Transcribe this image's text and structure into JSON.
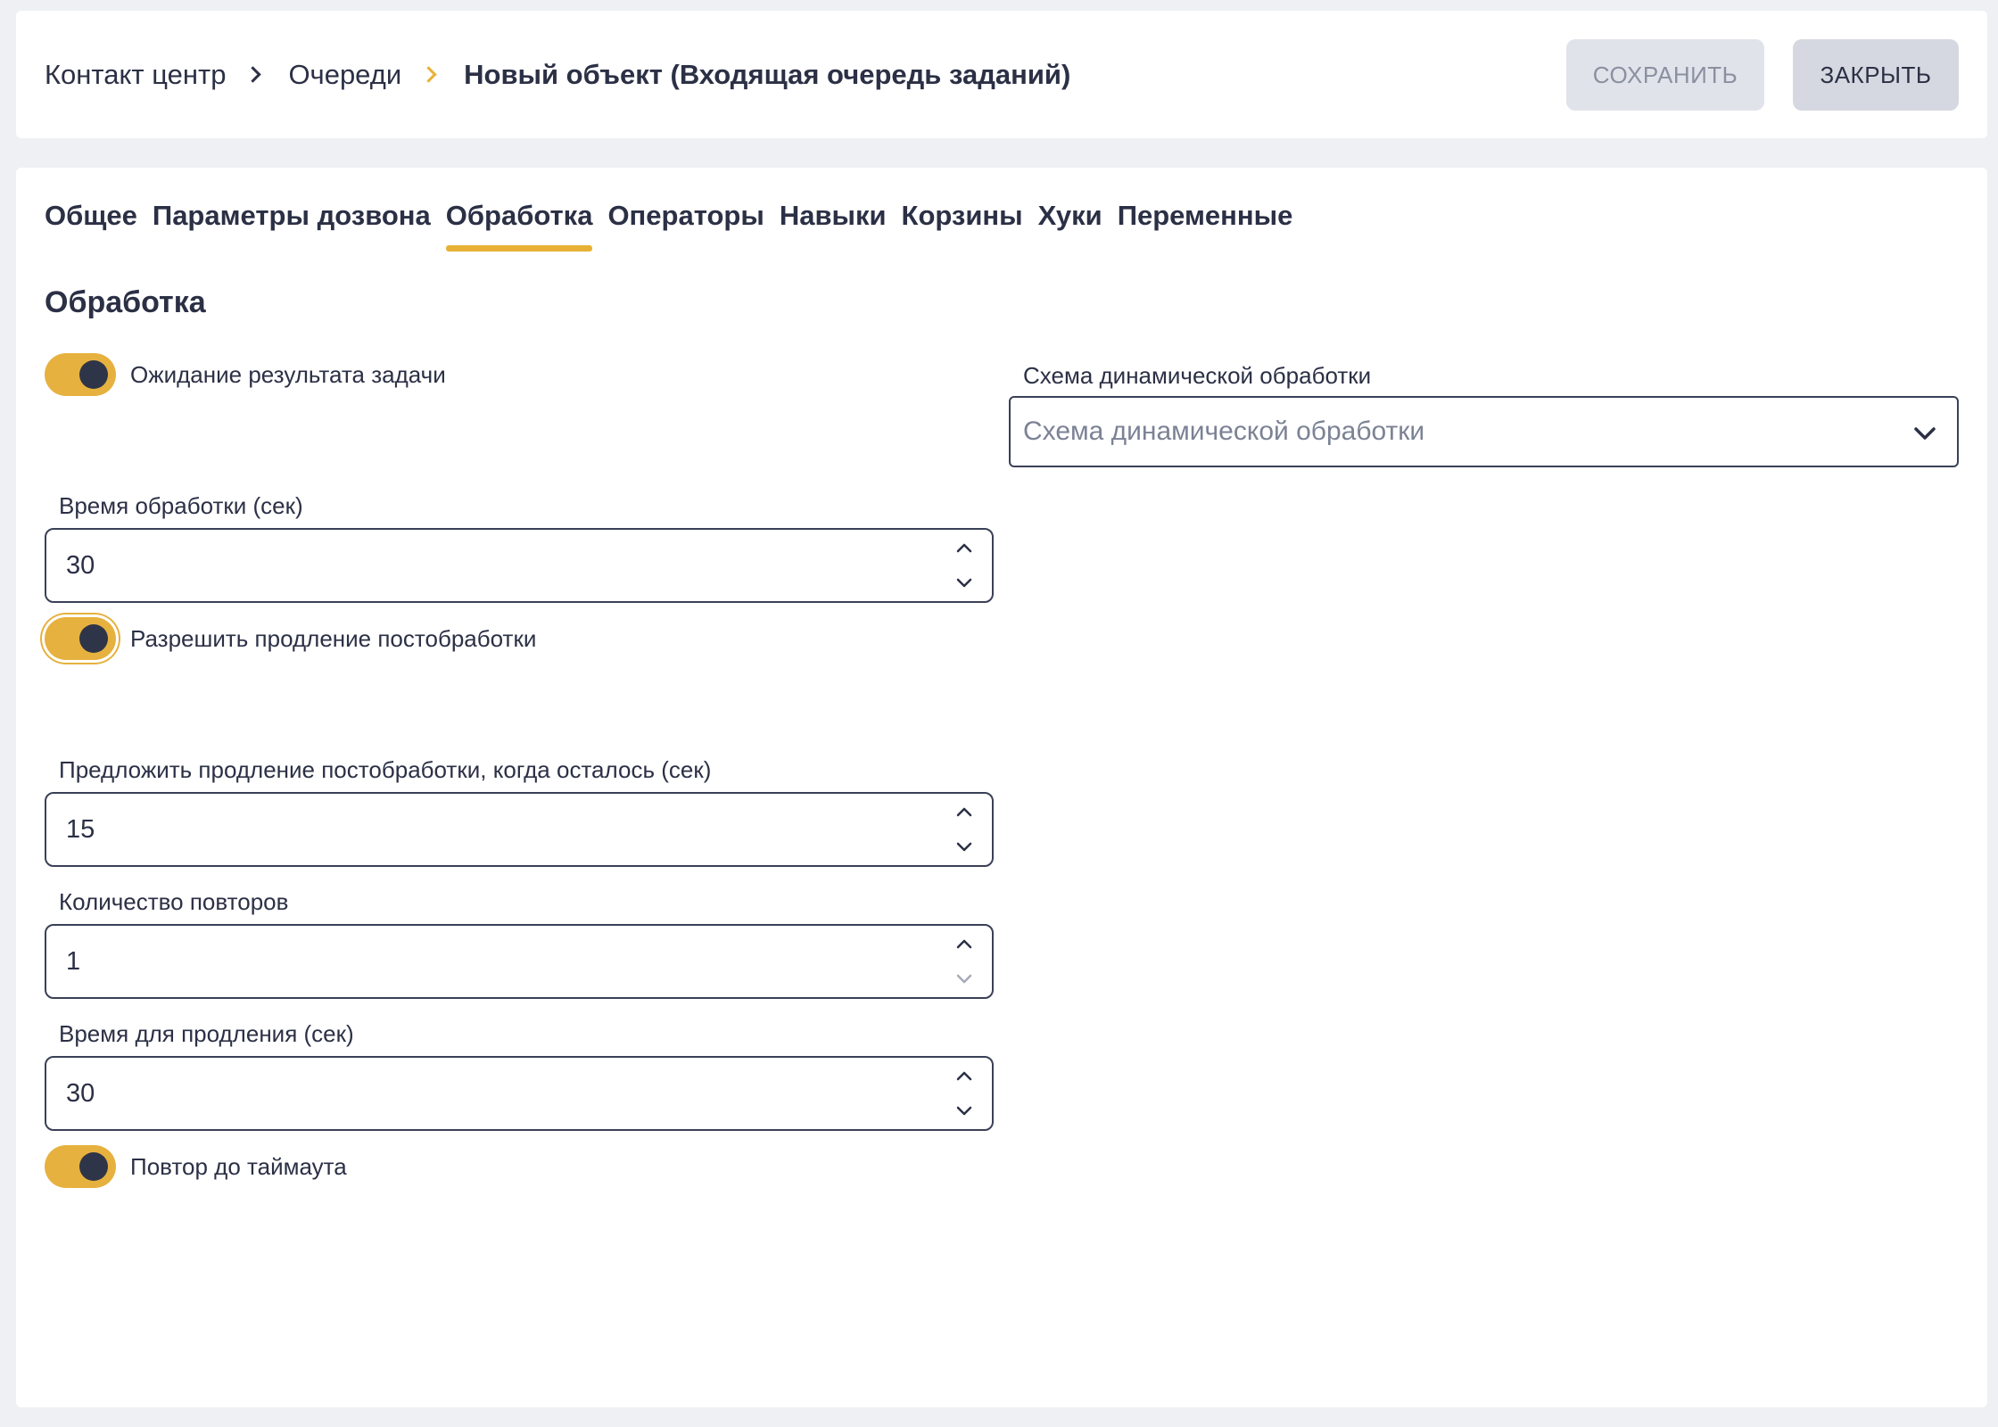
{
  "breadcrumb": {
    "items": [
      "Контакт центр",
      "Очереди"
    ],
    "current": "Новый объект (Входящая очередь заданий)"
  },
  "header": {
    "save_label": "СОХРАНИТЬ",
    "close_label": "ЗАКРЫТЬ"
  },
  "tabs": [
    {
      "label": "Общее"
    },
    {
      "label": "Параметры дозвона"
    },
    {
      "label": "Обработка",
      "active": true
    },
    {
      "label": "Операторы"
    },
    {
      "label": "Навыки"
    },
    {
      "label": "Корзины"
    },
    {
      "label": "Хуки"
    },
    {
      "label": "Переменные"
    }
  ],
  "section": {
    "title": "Обработка"
  },
  "form": {
    "wait_result": {
      "label": "Ожидание результата задачи",
      "checked": true
    },
    "dynamic_scheme": {
      "label": "Схема динамической обработки",
      "placeholder": "Схема динамической обработки"
    },
    "processing_time": {
      "label": "Время обработки (сек)",
      "value": "30"
    },
    "allow_extension": {
      "label": "Разрешить продление постобработки",
      "checked": true
    },
    "offer_extension": {
      "label": "Предложить продление постобработки, когда осталось (сек)",
      "value": "15"
    },
    "repeat_count": {
      "label": "Количество повторов",
      "value": "1"
    },
    "extension_time": {
      "label": "Время для продления (сек)",
      "value": "30"
    },
    "repeat_until_timeout": {
      "label": "Повтор до таймаута",
      "checked": true
    }
  },
  "colors": {
    "accent": "#e8b136",
    "toggle_on": "#e6b13f",
    "text": "#2b3045",
    "background": "#eff0f3"
  },
  "icons": {
    "breadcrumb_separator": "chevron-right-icon",
    "select_arrow": "chevron-down-icon",
    "spin_up": "chevron-up-icon",
    "spin_down": "chevron-down-icon"
  }
}
